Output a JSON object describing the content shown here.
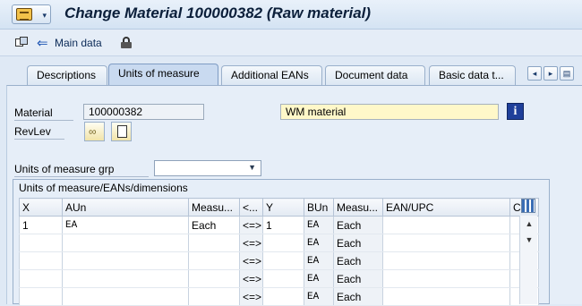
{
  "window": {
    "title": "Change Material 100000382 (Raw material)"
  },
  "toolbar": {
    "main_data_label": "Main data"
  },
  "tabs": [
    {
      "label": "Descriptions",
      "active": false
    },
    {
      "label": "Units of measure",
      "active": true
    },
    {
      "label": "Additional EANs",
      "active": false
    },
    {
      "label": "Document data",
      "active": false
    },
    {
      "label": "Basic data t...",
      "active": false
    }
  ],
  "tab_nav": {
    "left": "◂",
    "right": "▸",
    "list": "▤"
  },
  "header": {
    "material_label": "Material",
    "material_value": "100000382",
    "material_desc": "WM material",
    "revlev_label": "RevLev"
  },
  "uom_group": {
    "label": "Units of measure grp",
    "value": ""
  },
  "table": {
    "group_title": "Units of measure/EANs/dimensions",
    "columns": [
      "X",
      "AUn",
      "Measu...",
      "<...",
      "Y",
      "BUn",
      "Measu...",
      "EAN/UPC",
      "C"
    ],
    "rows": [
      {
        "x": "1",
        "aun": "EA",
        "measure": "Each",
        "sign": "<=>",
        "y": "1",
        "bun": "EA",
        "measure2": "Each",
        "ean": "",
        "c": ""
      },
      {
        "x": "",
        "aun": "",
        "measure": "",
        "sign": "<=>",
        "y": "",
        "bun": "EA",
        "measure2": "Each",
        "ean": "",
        "c": ""
      },
      {
        "x": "",
        "aun": "",
        "measure": "",
        "sign": "<=>",
        "y": "",
        "bun": "EA",
        "measure2": "Each",
        "ean": "",
        "c": ""
      },
      {
        "x": "",
        "aun": "",
        "measure": "",
        "sign": "<=>",
        "y": "",
        "bun": "EA",
        "measure2": "Each",
        "ean": "",
        "c": ""
      },
      {
        "x": "",
        "aun": "",
        "measure": "",
        "sign": "<=>",
        "y": "",
        "bun": "EA",
        "measure2": "Each",
        "ean": "",
        "c": ""
      }
    ]
  },
  "colors": {
    "accent": "#1f3f9a",
    "panel": "#e6eef8",
    "highlight": "#fff8c9"
  }
}
